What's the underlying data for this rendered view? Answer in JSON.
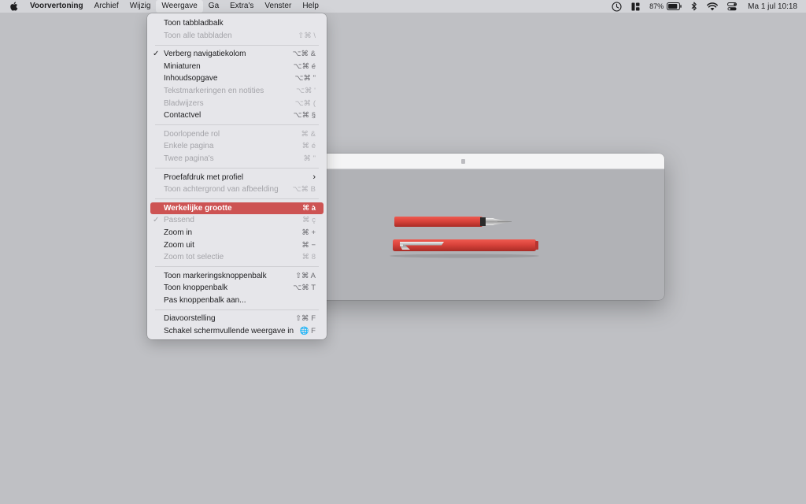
{
  "menubar": {
    "app_name": "Voorvertoning",
    "items": [
      "Archief",
      "Wijzig",
      "Weergave",
      "Ga",
      "Extra's",
      "Venster",
      "Help"
    ],
    "active_item": "Weergave",
    "battery_percent": "87%",
    "clock": "Ma 1 jul  10:18",
    "status_icons": [
      "screen-time-icon",
      "stage-manager-icon",
      "battery-icon",
      "bluetooth-icon",
      "wifi-icon",
      "control-center-icon"
    ]
  },
  "menu": {
    "groups": [
      [
        {
          "label": "Toon tabbladbalk",
          "shortcut": "",
          "enabled": true
        },
        {
          "label": "Toon alle tabbladen",
          "shortcut": "⇧⌘ \\",
          "enabled": false
        }
      ],
      [
        {
          "label": "Verberg navigatiekolom",
          "shortcut": "⌥⌘ &",
          "enabled": true,
          "checked": true
        },
        {
          "label": "Miniaturen",
          "shortcut": "⌥⌘ é",
          "enabled": true
        },
        {
          "label": "Inhoudsopgave",
          "shortcut": "⌥⌘ \"",
          "enabled": true
        },
        {
          "label": "Tekstmarkeringen en notities",
          "shortcut": "⌥⌘ '",
          "enabled": false
        },
        {
          "label": "Bladwijzers",
          "shortcut": "⌥⌘ (",
          "enabled": false
        },
        {
          "label": "Contactvel",
          "shortcut": "⌥⌘ §",
          "enabled": true
        }
      ],
      [
        {
          "label": "Doorlopende rol",
          "shortcut": "⌘ &",
          "enabled": false
        },
        {
          "label": "Enkele pagina",
          "shortcut": "⌘ é",
          "enabled": false
        },
        {
          "label": "Twee pagina's",
          "shortcut": "⌘ \"",
          "enabled": false
        }
      ],
      [
        {
          "label": "Proefafdruk met profiel",
          "shortcut": "",
          "enabled": true,
          "submenu": true
        },
        {
          "label": "Toon achtergrond van afbeelding",
          "shortcut": "⌥⌘ B",
          "enabled": false
        }
      ],
      [
        {
          "label": "Werkelijke grootte",
          "shortcut": "⌘ à",
          "enabled": true,
          "highlighted": true
        },
        {
          "label": "Passend",
          "shortcut": "⌘ ç",
          "enabled": false,
          "checked": true
        },
        {
          "label": "Zoom in",
          "shortcut": "⌘ +",
          "enabled": true
        },
        {
          "label": "Zoom uit",
          "shortcut": "⌘ −",
          "enabled": true
        },
        {
          "label": "Zoom tot selectie",
          "shortcut": "⌘ 8",
          "enabled": false
        }
      ],
      [
        {
          "label": "Toon markeringsknoppenbalk",
          "shortcut": "⇧⌘ A",
          "enabled": true
        },
        {
          "label": "Toon knoppenbalk",
          "shortcut": "⌥⌘ T",
          "enabled": true
        },
        {
          "label": "Pas knoppenbalk aan...",
          "shortcut": "",
          "enabled": true
        }
      ],
      [
        {
          "label": "Diavoorstelling",
          "shortcut": "⇧⌘ F",
          "enabled": true
        },
        {
          "label": "Schakel schermvullende weergave in",
          "shortcut": "🌐 F",
          "enabled": true
        }
      ]
    ]
  },
  "window": {
    "title": ""
  },
  "colors": {
    "desktop": "#bfc0c4",
    "highlight": "#cd5353",
    "pen_red": "#d9433b"
  }
}
